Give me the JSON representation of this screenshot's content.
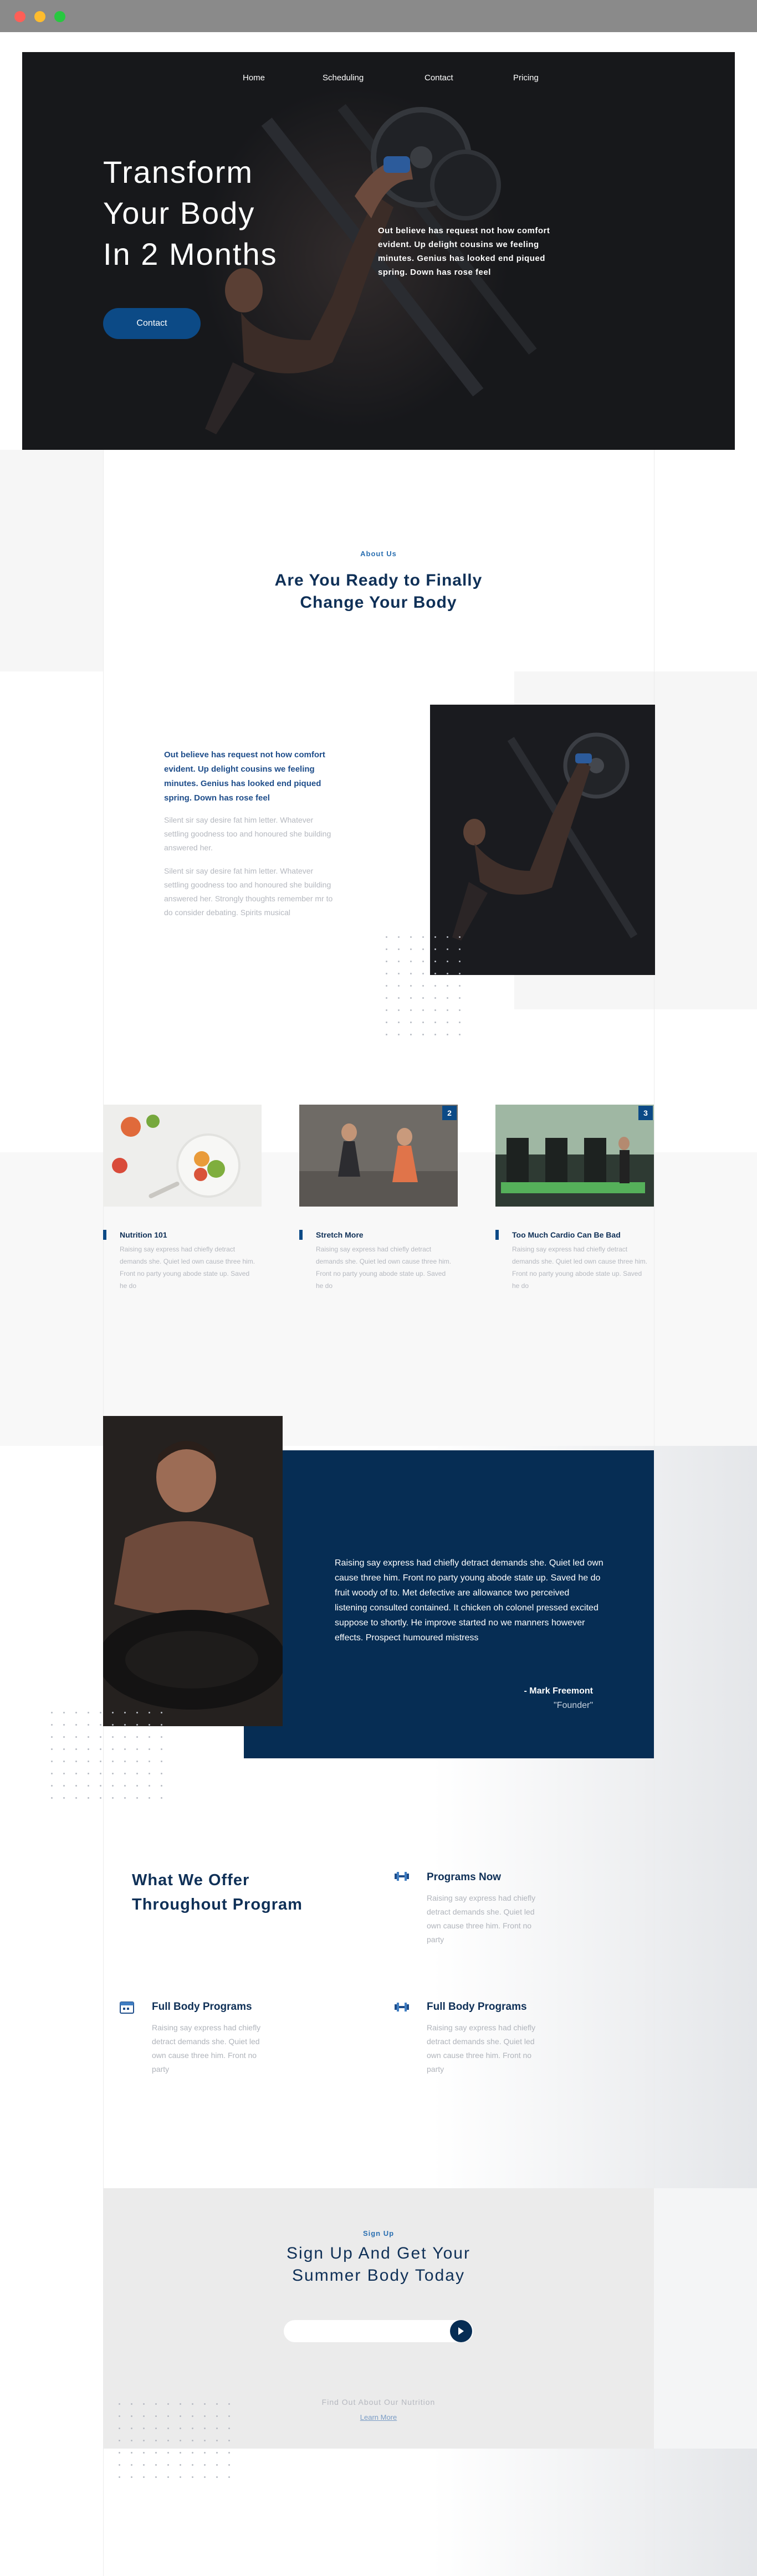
{
  "nav": {
    "items": [
      "Home",
      "Scheduling",
      "Contact",
      "Pricing"
    ]
  },
  "hero": {
    "title_lines": [
      "Transform",
      "Your Body",
      "In 2 Months"
    ],
    "text": "Out believe has request not how comfort evident. Up delight cousins we feeling minutes. Genius has looked end piqued spring. Down has rose feel",
    "button": "Contact"
  },
  "about": {
    "eyebrow": "About Us",
    "title": "Are You Ready to Finally Change Your Body",
    "lead": "Out believe has request not how comfort evident. Up delight cousins we feeling minutes. Genius has looked end piqued spring. Down has rose feel",
    "p1": "Silent sir say desire fat him letter. Whatever settling goodness too and honoured she building answered her.",
    "p2": "Silent sir say desire fat him letter. Whatever settling goodness too and honoured she building answered her. Strongly thoughts remember mr to do consider debating. Spirits musical"
  },
  "cards": [
    {
      "title": "Nutrition 101",
      "badge": "",
      "text": "Raising say express had chiefly detract demands she. Quiet led own cause three him. Front no party young abode state up. Saved he do"
    },
    {
      "title": "Stretch More",
      "badge": "2",
      "text": "Raising say express had chiefly detract demands she. Quiet led own cause three him. Front no party young abode state up. Saved he do"
    },
    {
      "title": "Too Much Cardio Can Be Bad",
      "badge": "3",
      "text": "Raising say express had chiefly detract demands she. Quiet led own cause three him. Front no party young abode state up. Saved he do"
    }
  ],
  "testimonial": {
    "quote": "Raising say express had chiefly detract demands she. Quiet led own cause three him. Front no party young abode state up. Saved he do fruit woody of to. Met defective are allowance two perceived listening consulted contained. It chicken oh colonel pressed excited suppose to shortly. He improve started no we manners however effects. Prospect humoured mistress",
    "name": "- Mark Freemont",
    "role": "\"Founder\""
  },
  "offers": {
    "title": "What We Offer Throughout Program",
    "items": [
      {
        "title": "Programs Now",
        "icon": "dumbbell-icon",
        "text": "Raising say express had chiefly detract demands she. Quiet led own cause three him. Front no party"
      },
      {
        "title": "Full Body Programs",
        "icon": "calendar-icon",
        "text": "Raising say express had chiefly detract demands she. Quiet led own cause three him. Front no party"
      },
      {
        "title": "Full Body Programs",
        "icon": "dumbbell-icon",
        "text": "Raising say express had chiefly detract demands she. Quiet led own cause three him. Front no party"
      }
    ]
  },
  "signup": {
    "eyebrow": "Sign Up",
    "title": "Sign Up And Get Your Summer Body Today",
    "input_value": "",
    "more": "Find Out About Our Nutrition",
    "learn": "Learn More"
  },
  "colors": {
    "primary": "#0f3057",
    "accent": "#0c4a86",
    "dark_box": "#062d54",
    "hero_bg": "#17181b"
  }
}
